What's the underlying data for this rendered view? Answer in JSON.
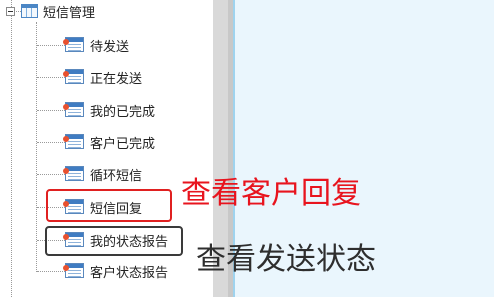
{
  "tree": {
    "root": {
      "label": "短信管理",
      "expander": "minus-icon",
      "icon": "table-folder-icon"
    },
    "items": [
      {
        "label": "待发送",
        "icon": "table-icon"
      },
      {
        "label": "正在发送",
        "icon": "table-icon"
      },
      {
        "label": "我的已完成",
        "icon": "table-icon"
      },
      {
        "label": "客户已完成",
        "icon": "table-icon"
      },
      {
        "label": "循环短信",
        "icon": "table-icon"
      },
      {
        "label": "短信回复",
        "icon": "table-icon"
      },
      {
        "label": "我的状态报告",
        "icon": "table-icon"
      },
      {
        "label": "客户状态报告",
        "icon": "table-icon"
      }
    ]
  },
  "annotations": {
    "red": {
      "text": "查看客户回复",
      "color": "#e8141e"
    },
    "dark": {
      "text": "查看发送状态",
      "color": "#2e2e2e"
    }
  },
  "colors": {
    "content_bg": "#eaf6fd",
    "splitter": "#d9d9d9",
    "highlight_red": "#e02020",
    "highlight_dark": "#3a3a3a"
  }
}
